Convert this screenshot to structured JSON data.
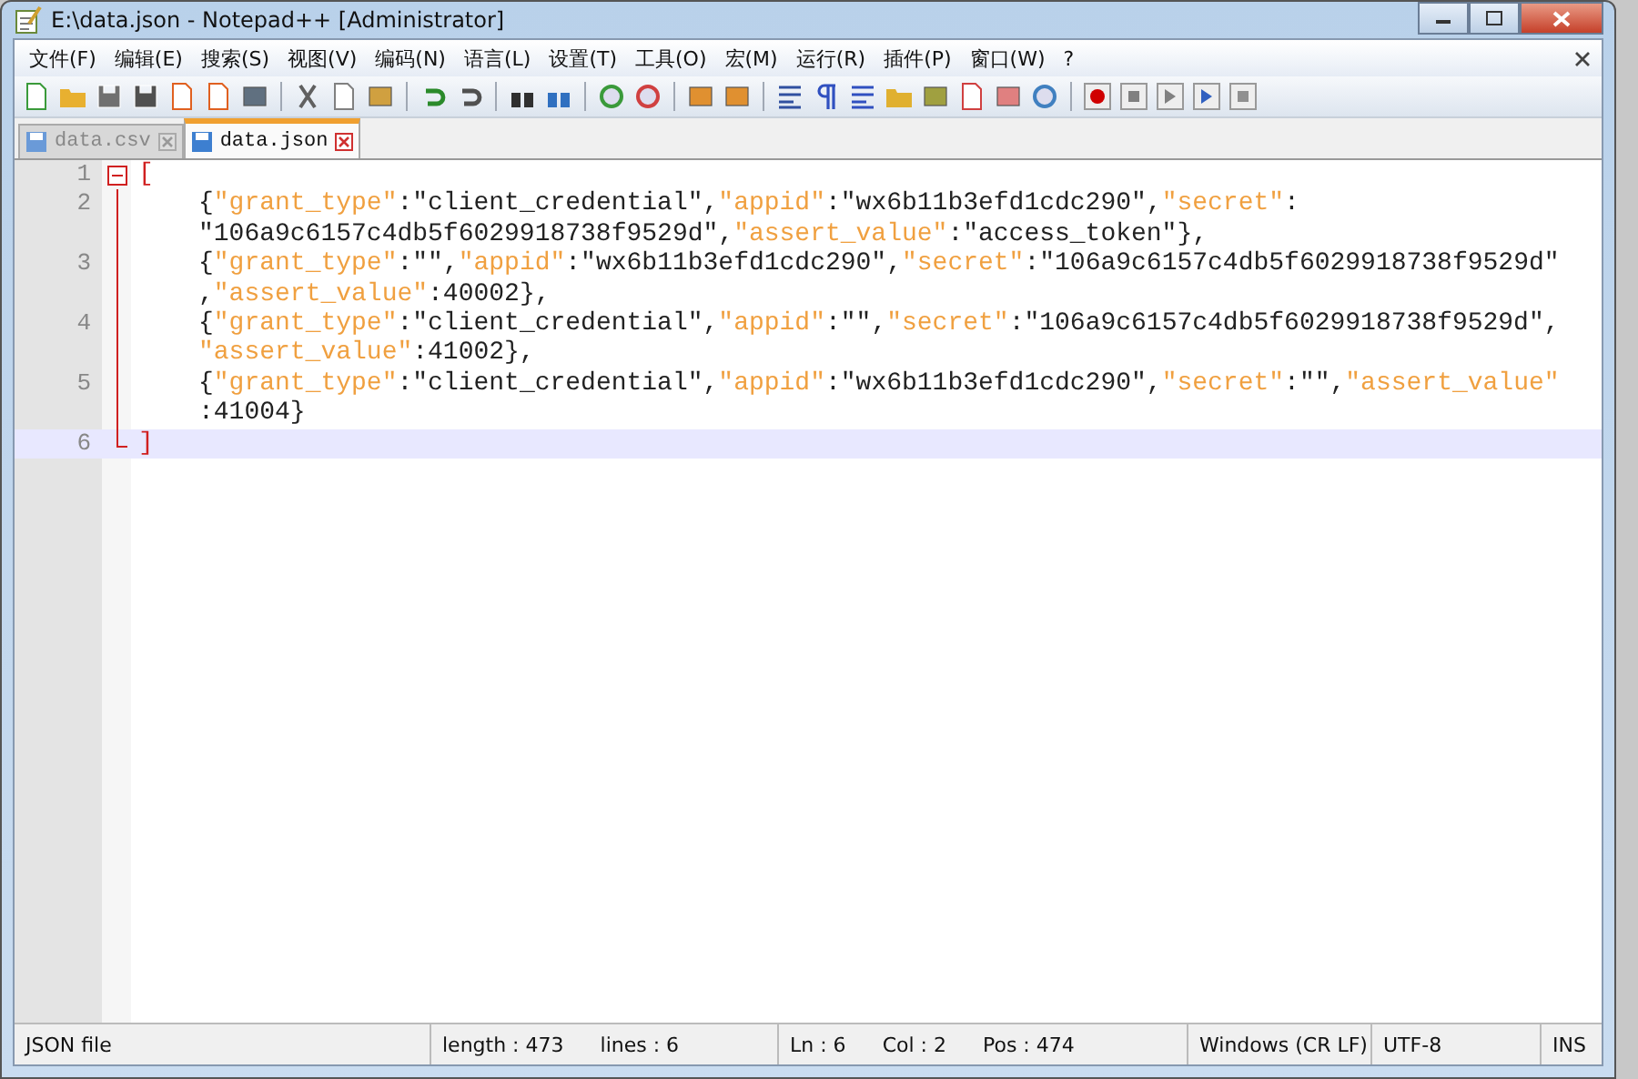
{
  "window": {
    "title": "E:\\data.json - Notepad++ [Administrator]"
  },
  "menu": [
    "文件(F)",
    "编辑(E)",
    "搜索(S)",
    "视图(V)",
    "编码(N)",
    "语言(L)",
    "设置(T)",
    "工具(O)",
    "宏(M)",
    "运行(R)",
    "插件(P)",
    "窗口(W)",
    "?"
  ],
  "tabs": [
    {
      "label": "data.csv",
      "selected": false
    },
    {
      "label": "data.json",
      "selected": true
    }
  ],
  "editor": {
    "lines": [
      {
        "number": "1",
        "kind": "start",
        "indent": false,
        "current": false,
        "segments": [
          {
            "tokens": [
              {
                "kind": "bracket",
                "text": "["
              }
            ]
          }
        ]
      },
      {
        "number": "2",
        "kind": "inner",
        "indent": true,
        "current": false,
        "segments": [
          {
            "tokens": [
              {
                "kind": "plain",
                "text": "{"
              },
              {
                "kind": "key",
                "text": "\"grant_type\""
              },
              {
                "kind": "plain",
                "text": ":\"client_credential\","
              },
              {
                "kind": "key",
                "text": "\"appid\""
              },
              {
                "kind": "plain",
                "text": ":\"wx6b11b3efd1cdc290\","
              },
              {
                "kind": "key",
                "text": "\"secret\""
              },
              {
                "kind": "plain",
                "text": ":"
              }
            ]
          },
          {
            "tokens": [
              {
                "kind": "plain",
                "text": "\"106a9c6157c4db5f6029918738f9529d\","
              },
              {
                "kind": "key",
                "text": "\"assert_value\""
              },
              {
                "kind": "plain",
                "text": ":\"access_token\"},"
              }
            ]
          }
        ]
      },
      {
        "number": "3",
        "kind": "inner",
        "indent": true,
        "current": false,
        "segments": [
          {
            "tokens": [
              {
                "kind": "plain",
                "text": "{"
              },
              {
                "kind": "key",
                "text": "\"grant_type\""
              },
              {
                "kind": "plain",
                "text": ":\"\","
              },
              {
                "kind": "key",
                "text": "\"appid\""
              },
              {
                "kind": "plain",
                "text": ":\"wx6b11b3efd1cdc290\","
              },
              {
                "kind": "key",
                "text": "\"secret\""
              },
              {
                "kind": "plain",
                "text": ":\"106a9c6157c4db5f6029918738f9529d\""
              }
            ]
          },
          {
            "tokens": [
              {
                "kind": "plain",
                "text": ","
              },
              {
                "kind": "key",
                "text": "\"assert_value\""
              },
              {
                "kind": "plain",
                "text": ":40002},"
              }
            ]
          }
        ]
      },
      {
        "number": "4",
        "kind": "inner",
        "indent": true,
        "current": false,
        "segments": [
          {
            "tokens": [
              {
                "kind": "plain",
                "text": "{"
              },
              {
                "kind": "key",
                "text": "\"grant_type\""
              },
              {
                "kind": "plain",
                "text": ":\"client_credential\","
              },
              {
                "kind": "key",
                "text": "\"appid\""
              },
              {
                "kind": "plain",
                "text": ":\"\","
              },
              {
                "kind": "key",
                "text": "\"secret\""
              },
              {
                "kind": "plain",
                "text": ":\"106a9c6157c4db5f6029918738f9529d\","
              }
            ]
          },
          {
            "tokens": [
              {
                "kind": "key",
                "text": "\"assert_value\""
              },
              {
                "kind": "plain",
                "text": ":41002},"
              }
            ]
          }
        ]
      },
      {
        "number": "5",
        "kind": "inner",
        "indent": true,
        "current": false,
        "segments": [
          {
            "tokens": [
              {
                "kind": "plain",
                "text": "{"
              },
              {
                "kind": "key",
                "text": "\"grant_type\""
              },
              {
                "kind": "plain",
                "text": ":\"client_credential\","
              },
              {
                "kind": "key",
                "text": "\"appid\""
              },
              {
                "kind": "plain",
                "text": ":\"wx6b11b3efd1cdc290\","
              },
              {
                "kind": "key",
                "text": "\"secret\""
              },
              {
                "kind": "plain",
                "text": ":\"\","
              },
              {
                "kind": "key",
                "text": "\"assert_value\""
              }
            ]
          },
          {
            "tokens": [
              {
                "kind": "plain",
                "text": ":41004}"
              }
            ]
          }
        ]
      },
      {
        "number": "6",
        "kind": "end",
        "indent": false,
        "current": true,
        "segments": [
          {
            "tokens": [
              {
                "kind": "bracket",
                "text": "]"
              }
            ]
          }
        ]
      }
    ]
  },
  "status_bar": [
    {
      "items": [
        "JSON file"
      ]
    },
    {
      "items": [
        "length : 473",
        "lines : 6"
      ]
    },
    {
      "items": [
        "Ln : 6",
        "Col : 2",
        "Pos : 474"
      ]
    },
    {
      "items": [
        "Windows (CR LF)"
      ]
    },
    {
      "items": [
        "UTF-8"
      ]
    },
    {
      "items": [
        "INS"
      ]
    }
  ]
}
